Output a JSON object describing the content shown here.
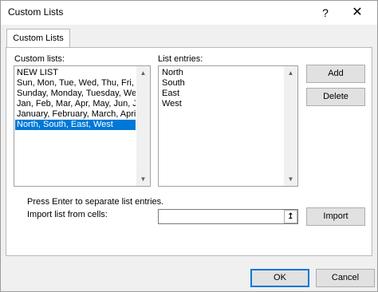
{
  "window": {
    "title": "Custom Lists",
    "help_glyph": "?",
    "close_glyph": "✕"
  },
  "tab": {
    "label": "Custom Lists"
  },
  "custom_lists": {
    "label": "Custom lists:",
    "items": [
      "NEW LIST",
      "Sun, Mon, Tue, Wed, Thu, Fri, Sat",
      "Sunday, Monday, Tuesday, Wednesday, Thursday, Friday, Saturday",
      "Jan, Feb, Mar, Apr, May, Jun, Jul, Aug, Sep, Oct, Nov, Dec",
      "January, February, March, April, May, June, July, August, September, October, November, December",
      "North, South, East, West"
    ],
    "selected_index": 5
  },
  "list_entries": {
    "label": "List entries:",
    "items": [
      "North",
      "South",
      "East",
      "West"
    ]
  },
  "buttons": {
    "add": "Add",
    "delete": "Delete",
    "import": "Import",
    "ok": "OK",
    "cancel": "Cancel"
  },
  "hint": "Press Enter to separate list entries.",
  "import_label": "Import list from cells:",
  "import_value": "",
  "icons": {
    "collapse": "↥",
    "scroll_up": "▲",
    "scroll_down": "▼"
  }
}
